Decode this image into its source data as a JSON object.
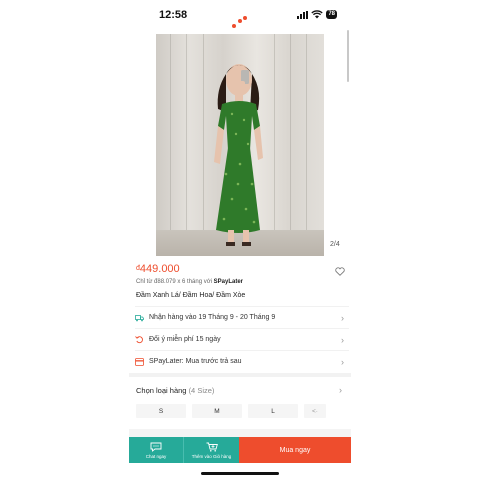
{
  "status_bar": {
    "time": "12:58",
    "battery": "78"
  },
  "product": {
    "image_counter": "2/4",
    "price_currency": "đ",
    "price": "449.000",
    "installment_prefix": "Chỉ từ đ88.079 x 6 tháng với",
    "installment_brand": "SPayLater",
    "title": "Đầm Xanh Lá/ Đầm Hoa/ Đầm Xòe"
  },
  "info_rows": [
    {
      "icon": "truck-icon",
      "text": "Nhận hàng vào 19 Tháng 9 - 20 Tháng 9"
    },
    {
      "icon": "return-icon",
      "text": "Đổi ý miễn phí 15 ngày"
    },
    {
      "icon": "spaylater-icon",
      "text": "SPayLater: Mua trước trả sau"
    }
  ],
  "variants": {
    "title": "Chọn loại hàng",
    "count": "(4 Size)",
    "sizes": [
      "S",
      "M",
      "L",
      "<·"
    ]
  },
  "bottom_bar": {
    "chat_label": "Chat ngay",
    "cart_label": "Thêm vào Giỏ hàng",
    "buy_label": "Mua ngay"
  },
  "colors": {
    "accent": "#ee4d2d",
    "teal": "#26aa99"
  }
}
